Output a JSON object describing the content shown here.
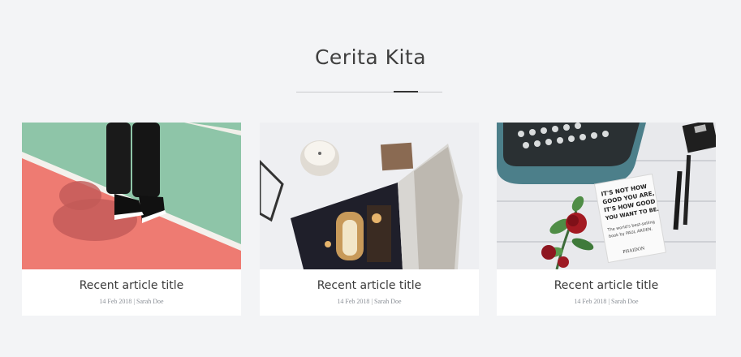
{
  "section": {
    "title": "Cerita Kita"
  },
  "articles": [
    {
      "title": "Recent article title",
      "date": "14 Feb 2018",
      "separator": "|",
      "author": "Sarah Doe",
      "image": "sneakers-on-court-photo"
    },
    {
      "title": "Recent article title",
      "date": "14 Feb 2018",
      "separator": "|",
      "author": "Sarah Doe",
      "image": "magazine-and-candle-photo"
    },
    {
      "title": "Recent article title",
      "date": "14 Feb 2018",
      "separator": "|",
      "author": "Sarah Doe",
      "image": "typewriter-book-rose-photo"
    }
  ],
  "book_cover": {
    "line1": "IT'S NOT HOW",
    "line2": "GOOD YOU ARE,",
    "line3": "IT'S HOW GOOD",
    "line4": "YOU WANT TO BE.",
    "sub1": "The world's best-selling",
    "sub2": "book by PAUL ARDEN.",
    "publisher": "PHAIDON"
  },
  "colors": {
    "background": "#f3f4f6",
    "card": "#ffffff",
    "title": "#3a3a3a",
    "meta": "#8a8f96",
    "accent_line": "#333333"
  }
}
